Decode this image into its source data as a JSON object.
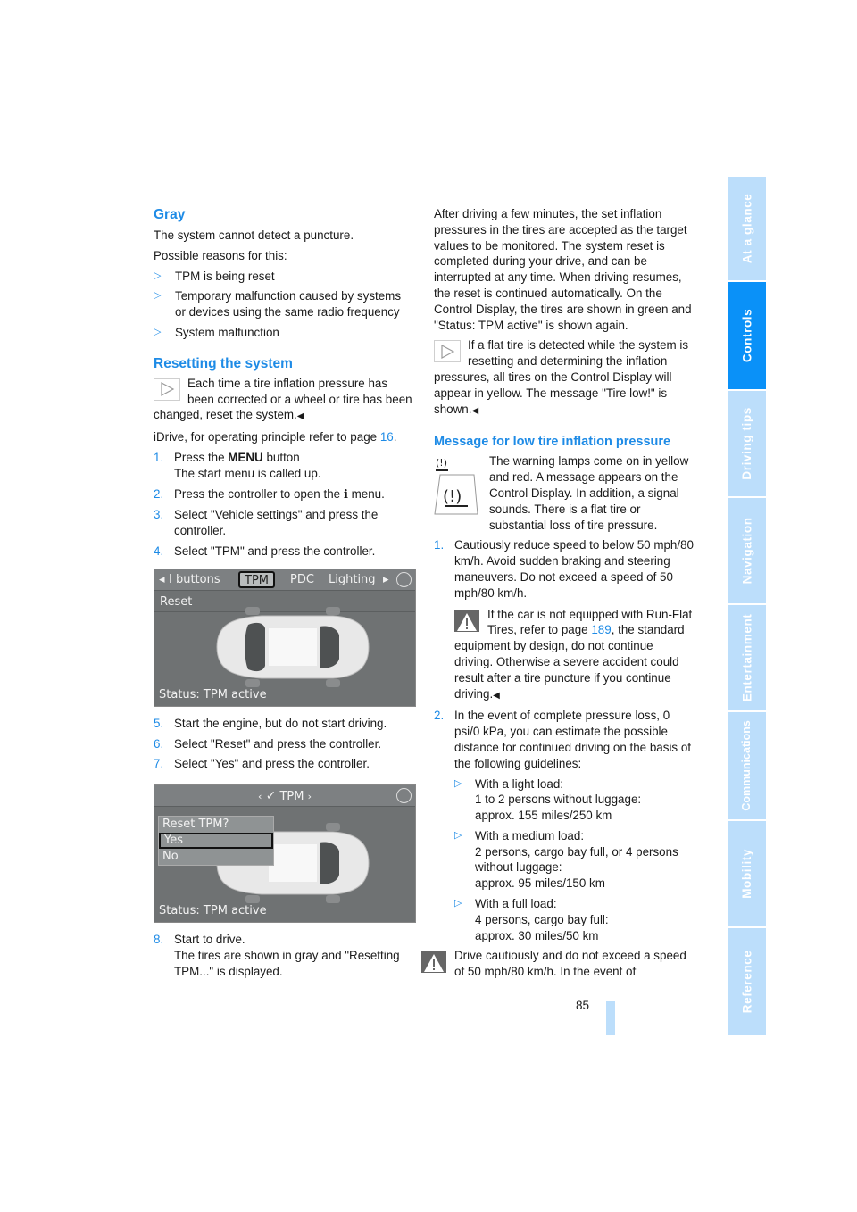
{
  "left_column": {
    "gray_heading": "Gray",
    "gray_para1": "The system cannot detect a puncture.",
    "gray_para2": "Possible reasons for this:",
    "gray_bullets": [
      "TPM is being reset",
      "Temporary malfunction caused by systems or devices using the same radio frequency",
      "System malfunction"
    ],
    "bullet_marker": "▷",
    "reset_heading": "Resetting the system",
    "reset_note": "Each time a tire inflation pressure has been corrected or a wheel or tire has been changed, reset the system.",
    "end_marker": "◀",
    "idrive_text": "iDrive, for operating principle refer to page ",
    "idrive_page": "16",
    "idrive_period": ".",
    "steps_a": [
      {
        "num": "1.",
        "pre": "Press the ",
        "bold": "MENU",
        "post": " button",
        "line2": "The start menu is called up."
      },
      {
        "num": "2.",
        "pre": "Press the controller to open the ",
        "icon": "i",
        "post": " menu."
      },
      {
        "num": "3.",
        "text": "Select \"Vehicle settings\" and press the controller."
      },
      {
        "num": "4.",
        "text": "Select \"TPM\" and press the controller."
      }
    ],
    "screen1": {
      "tabs": [
        "I buttons",
        "TPM",
        "PDC",
        "Lighting"
      ],
      "left_arrow": "◂",
      "right_arrow": "▸",
      "menu_item": "Reset",
      "status": "Status: TPM active"
    },
    "steps_b": [
      {
        "num": "5.",
        "text": "Start the engine, but do not start driving."
      },
      {
        "num": "6.",
        "text": "Select \"Reset\" and press the controller."
      },
      {
        "num": "7.",
        "text": "Select \"Yes\" and press the controller."
      }
    ],
    "screen2": {
      "title": "TPM",
      "left_arrow": "‹",
      "right_arrow": "›",
      "popup_title": "Reset TPM?",
      "popup_yes": "Yes",
      "popup_no": "No",
      "status": "Status: TPM active"
    },
    "steps_c": [
      {
        "num": "8.",
        "text": "Start to drive.",
        "line2": "The tires are shown in gray and \"Resetting TPM...\" is displayed."
      }
    ]
  },
  "right_column": {
    "after_para": "After driving a few minutes, the set inflation pressures in the tires are accepted as the target values to be monitored. The system reset is completed during your drive, and can be interrupted at any time. When driving resumes, the reset is continued automatically. On the Control Display, the tires are shown in green and \"Status: TPM active\" is shown again.",
    "flat_note": "If a flat tire is detected while the system is resetting and determining the inflation pressures, all tires on the Control Display will appear in yellow. The message \"Tire low!\" is shown.",
    "low_heading": "Message for low tire inflation pressure",
    "low_para": "The warning lamps come on in yellow and red. A message appears on the Control Display. In addition, a signal sounds. There is a flat tire or substantial loss of tire pressure.",
    "step1_num": "1.",
    "step1_text": "Cautiously reduce speed to below 50 mph/80 km/h. Avoid sudden braking and steering maneuvers. Do not exceed a speed of 50 mph/80 km/h.",
    "runflat_pre": "If the car is not equipped with Run-Flat Tires, refer to page ",
    "runflat_page": "189",
    "runflat_post": ", the standard equipment by design, do not continue driving. Otherwise a severe accident could result after a tire puncture if you continue driving.",
    "step2_num": "2.",
    "step2_text": "In the event of complete pressure loss, 0 psi/0 kPa, you can estimate the possible distance for continued driving on the basis of the following guidelines:",
    "load_bullets": [
      {
        "title": "With a light load:",
        "desc": "1 to 2 persons without luggage:",
        "dist": "approx. 155 miles/250 km"
      },
      {
        "title": "With a medium load:",
        "desc": "2 persons, cargo bay full, or 4 persons without luggage:",
        "dist": "approx. 95 miles/150 km"
      },
      {
        "title": "With a full load:",
        "desc": "4 persons, cargo bay full:",
        "dist": "approx. 30 miles/50 km"
      }
    ],
    "final_warning": "Drive cautiously and do not exceed a speed of 50 mph/80 km/h. In the event of"
  },
  "side_tabs": [
    {
      "label": "At a glance",
      "active": false
    },
    {
      "label": "Controls",
      "active": true
    },
    {
      "label": "Driving tips",
      "active": false
    },
    {
      "label": "Navigation",
      "active": false
    },
    {
      "label": "Entertainment",
      "active": false
    },
    {
      "label": "Communications",
      "active": false
    },
    {
      "label": "Mobility",
      "active": false
    },
    {
      "label": "Reference",
      "active": false
    }
  ],
  "page_number": "85",
  "colors": {
    "accent": "#1e8be6",
    "tab_active": "#0a91f8",
    "tab_inactive": "#bcdefb"
  }
}
